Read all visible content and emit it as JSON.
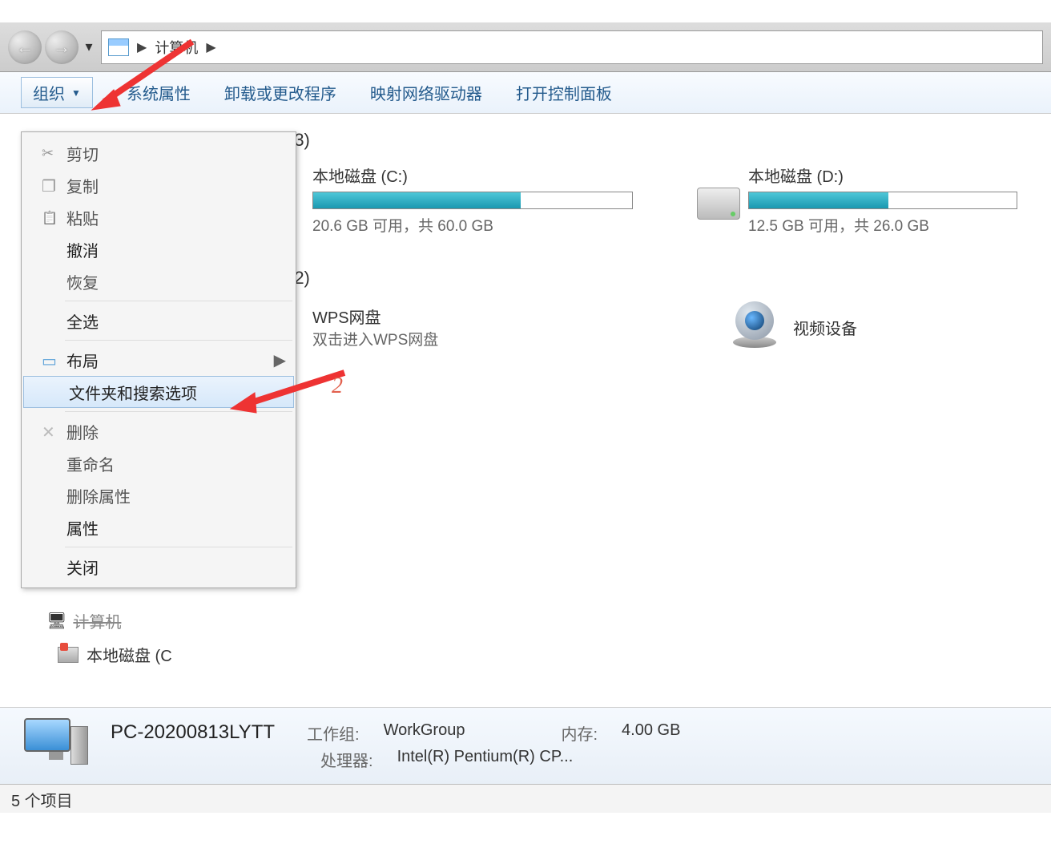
{
  "breadcrumb": {
    "location": "计算机"
  },
  "toolbar": {
    "organize": "组织",
    "system_props": "系统属性",
    "uninstall": "卸载或更改程序",
    "map_drive": "映射网络驱动器",
    "control_panel": "打开控制面板"
  },
  "organize_menu": {
    "cut": "剪切",
    "copy": "复制",
    "paste": "粘贴",
    "undo": "撤消",
    "redo": "恢复",
    "select_all": "全选",
    "layout": "布局",
    "folder_options": "文件夹和搜索选项",
    "delete": "删除",
    "rename": "重命名",
    "remove_props": "删除属性",
    "properties": "属性",
    "close": "关闭"
  },
  "sections": {
    "hard_drives_count": "(3)",
    "other_count": "(2)"
  },
  "drives": {
    "c": {
      "name": "本地磁盘 (C:)",
      "stats": "20.6 GB 可用，共 60.0 GB",
      "fill_pct": 65
    },
    "d": {
      "name": "本地磁盘 (D:)",
      "stats": "12.5 GB 可用，共 26.0 GB",
      "fill_pct": 52
    }
  },
  "other": {
    "wps_name": "WPS网盘",
    "wps_sub": "双击进入WPS网盘",
    "webcam": "视频设备"
  },
  "sidebar": {
    "computer": "计算机",
    "local_c": "本地磁盘 (C"
  },
  "details": {
    "pc_name": "PC-20200813LYTT",
    "workgroup_label": "工作组:",
    "workgroup": "WorkGroup",
    "memory_label": "内存:",
    "memory": "4.00 GB",
    "cpu_label": "处理器:",
    "cpu": "Intel(R) Pentium(R) CP..."
  },
  "status": {
    "items": "5 个项目"
  },
  "annotation": {
    "num2": "2"
  }
}
